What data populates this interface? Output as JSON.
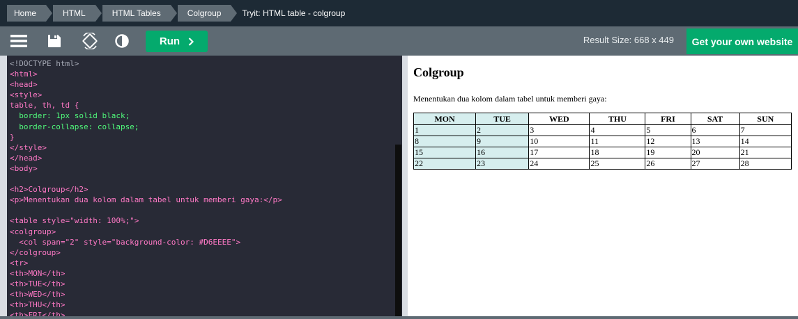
{
  "breadcrumb": {
    "items": [
      "Home",
      "HTML",
      "HTML Tables",
      "Colgroup"
    ],
    "current": "Tryit: HTML table - colgroup"
  },
  "toolbar": {
    "icons": [
      "menu-icon",
      "save-icon",
      "rotate-icon",
      "contrast-icon"
    ],
    "run_label": "Run",
    "run_icon": "chevron-right-icon",
    "result_size": "Result Size: 668 x 449",
    "get_website": "Get your own website"
  },
  "editor": {
    "lines": [
      "<!DOCTYPE html>",
      "<html>",
      "<head>",
      "<style>",
      "table, th, td {",
      "  border: 1px solid black;",
      "  border-collapse: collapse;",
      "}",
      "</style>",
      "</head>",
      "<body>",
      "",
      "<h2>Colgroup</h2>",
      "<p>Menentukan dua kolom dalam tabel untuk memberi gaya:</p>",
      "",
      "<table style=\"width: 100%;\">",
      "<colgroup>",
      "  <col span=\"2\" style=\"background-color: #D6EEEE\">",
      "</colgroup>",
      "<tr>",
      "<th>MON</th>",
      "<th>TUE</th>",
      "<th>WED</th>",
      "<th>THU</th>",
      "<th>FRI</th>"
    ]
  },
  "result": {
    "heading": "Colgroup",
    "paragraph": "Menentukan dua kolom dalam tabel untuk memberi gaya:",
    "col_highlight_color": "#D6EEEE",
    "table": {
      "headers": [
        "MON",
        "TUE",
        "WED",
        "THU",
        "FRI",
        "SAT",
        "SUN"
      ],
      "rows": [
        [
          "1",
          "2",
          "3",
          "4",
          "5",
          "6",
          "7"
        ],
        [
          "8",
          "9",
          "10",
          "11",
          "12",
          "13",
          "14"
        ],
        [
          "15",
          "16",
          "17",
          "18",
          "19",
          "20",
          "21"
        ],
        [
          "22",
          "23",
          "24",
          "25",
          "26",
          "27",
          "28"
        ]
      ]
    }
  },
  "colors": {
    "accent": "#04AA6D",
    "dark_bar": "#1D2A35",
    "toolbar": "#5E6A73",
    "editor_bg": "#282A36"
  }
}
